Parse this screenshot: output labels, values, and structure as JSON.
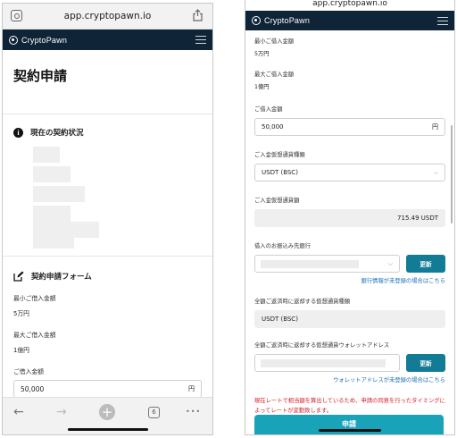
{
  "left": {
    "url": "app.cryptopawn.io",
    "brand": "CryptoPawn",
    "page_title": "契約申請",
    "status_heading": "現在の契約状況",
    "form_heading": "契約申請フォーム",
    "min_label": "最小ご借入金額",
    "min_value": "5万円",
    "max_label": "最大ご借入金額",
    "max_value": "1億円",
    "amount_label": "ご借入金額",
    "amount_value": "50,000",
    "amount_unit": "円",
    "toolbar": {
      "back": "←",
      "forward": "→",
      "plus": "+",
      "tabs_count": "6",
      "more": "•••"
    }
  },
  "right": {
    "url": "app.cryptopawn.io",
    "brand": "CryptoPawn",
    "min_label": "最小ご借入金額",
    "min_value": "5万円",
    "max_label": "最大ご借入金額",
    "max_value": "1億円",
    "amount_label": "ご借入金額",
    "amount_value": "50,000",
    "amount_unit": "円",
    "collateral_type_label": "ご入金仮想通貨種類",
    "collateral_type_value": "USDT (BSC)",
    "collateral_amount_label": "ご入金仮想通貨額",
    "collateral_amount_value": "715.49 USDT",
    "bank_label": "借入のお振込み先銀行",
    "update_button": "更新",
    "bank_link": "銀行情報が未登録の場合はこちら",
    "return_currency_label": "全額ご返済時に返却する仮想通貨種類",
    "return_currency_value": "USDT (BSC)",
    "wallet_label": "全額ご返済時に返却する仮想通貨ウォレットアドレス",
    "wallet_update_button": "更新",
    "wallet_link": "ウォレットアドレスが未登録の場合はこちら",
    "notice": "現在レートで相当額を算出しているため、申請の同意を行ったタイミングによってレートが変動致します。",
    "apply_button": "申請"
  },
  "colors": {
    "header": "#0f2436",
    "teal": "#127b95",
    "link": "#1a6fb5",
    "warning": "#d6222a",
    "apply": "#19a3b8"
  }
}
